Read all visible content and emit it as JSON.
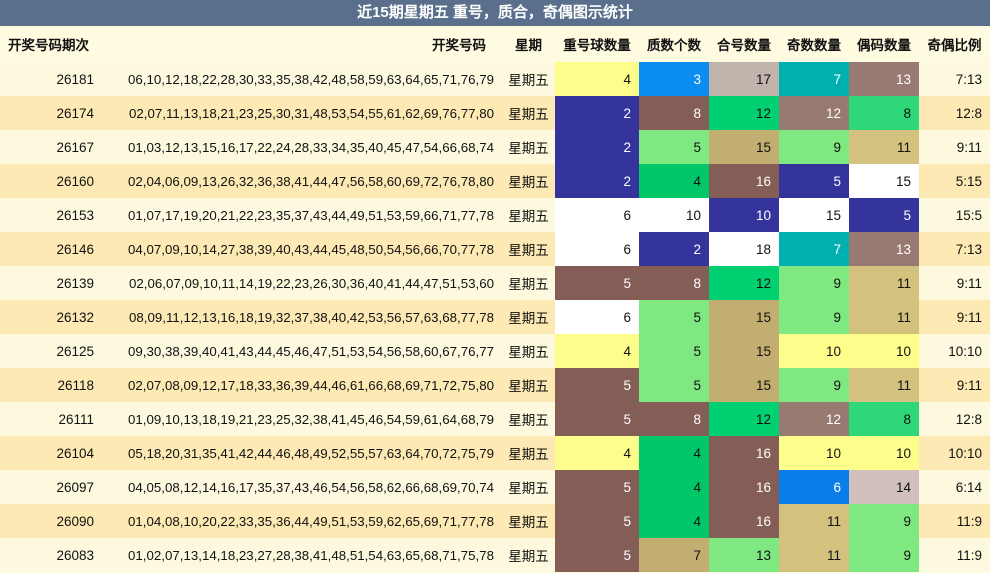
{
  "title": "近15期星期五 重号，质合，奇偶图示统计",
  "headers": {
    "issue": "开奖号码期次",
    "numbers": "开奖号码",
    "weekday": "星期",
    "repeat": "重号球数量",
    "prime": "质数个数",
    "composite": "合号数量",
    "odd": "奇数数量",
    "even": "偶码数量",
    "ratio": "奇偶比例"
  },
  "rows": [
    {
      "issue": "26181",
      "numbers": "06,10,12,18,22,28,30,33,35,38,42,48,58,59,63,64,65,71,76,79",
      "weekday": "星期五",
      "repeat": "4",
      "prime": "3",
      "composite": "17",
      "odd": "7",
      "even": "13",
      "ratio": "7:13"
    },
    {
      "issue": "26174",
      "numbers": "02,07,11,13,18,21,23,25,30,31,48,53,54,55,61,62,69,76,77,80",
      "weekday": "星期五",
      "repeat": "2",
      "prime": "8",
      "composite": "12",
      "odd": "12",
      "even": "8",
      "ratio": "12:8"
    },
    {
      "issue": "26167",
      "numbers": "01,03,12,13,15,16,17,22,24,28,33,34,35,40,45,47,54,66,68,74",
      "weekday": "星期五",
      "repeat": "2",
      "prime": "5",
      "composite": "15",
      "odd": "9",
      "even": "11",
      "ratio": "9:11"
    },
    {
      "issue": "26160",
      "numbers": "02,04,06,09,13,26,32,36,38,41,44,47,56,58,60,69,72,76,78,80",
      "weekday": "星期五",
      "repeat": "2",
      "prime": "4",
      "composite": "16",
      "odd": "5",
      "even": "15",
      "ratio": "5:15"
    },
    {
      "issue": "26153",
      "numbers": "01,07,17,19,20,21,22,23,35,37,43,44,49,51,53,59,66,71,77,78",
      "weekday": "星期五",
      "repeat": "6",
      "prime": "10",
      "composite": "10",
      "odd": "15",
      "even": "5",
      "ratio": "15:5"
    },
    {
      "issue": "26146",
      "numbers": "04,07,09,10,14,27,38,39,40,43,44,45,48,50,54,56,66,70,77,78",
      "weekday": "星期五",
      "repeat": "6",
      "prime": "2",
      "composite": "18",
      "odd": "7",
      "even": "13",
      "ratio": "7:13"
    },
    {
      "issue": "26139",
      "numbers": "02,06,07,09,10,11,14,19,22,23,26,30,36,40,41,44,47,51,53,60",
      "weekday": "星期五",
      "repeat": "5",
      "prime": "8",
      "composite": "12",
      "odd": "9",
      "even": "11",
      "ratio": "9:11"
    },
    {
      "issue": "26132",
      "numbers": "08,09,11,12,13,16,18,19,32,37,38,40,42,53,56,57,63,68,77,78",
      "weekday": "星期五",
      "repeat": "6",
      "prime": "5",
      "composite": "15",
      "odd": "9",
      "even": "11",
      "ratio": "9:11"
    },
    {
      "issue": "26125",
      "numbers": "09,30,38,39,40,41,43,44,45,46,47,51,53,54,56,58,60,67,76,77",
      "weekday": "星期五",
      "repeat": "4",
      "prime": "5",
      "composite": "15",
      "odd": "10",
      "even": "10",
      "ratio": "10:10"
    },
    {
      "issue": "26118",
      "numbers": "02,07,08,09,12,17,18,33,36,39,44,46,61,66,68,69,71,72,75,80",
      "weekday": "星期五",
      "repeat": "5",
      "prime": "5",
      "composite": "15",
      "odd": "9",
      "even": "11",
      "ratio": "9:11"
    },
    {
      "issue": "26111",
      "numbers": "01,09,10,13,18,19,21,23,25,32,38,41,45,46,54,59,61,64,68,79",
      "weekday": "星期五",
      "repeat": "5",
      "prime": "8",
      "composite": "12",
      "odd": "12",
      "even": "8",
      "ratio": "12:8"
    },
    {
      "issue": "26104",
      "numbers": "05,18,20,31,35,41,42,44,46,48,49,52,55,57,63,64,70,72,75,79",
      "weekday": "星期五",
      "repeat": "4",
      "prime": "4",
      "composite": "16",
      "odd": "10",
      "even": "10",
      "ratio": "10:10"
    },
    {
      "issue": "26097",
      "numbers": "04,05,08,12,14,16,17,35,37,43,46,54,56,58,62,66,68,69,70,74",
      "weekday": "星期五",
      "repeat": "5",
      "prime": "4",
      "composite": "16",
      "odd": "6",
      "even": "14",
      "ratio": "6:14"
    },
    {
      "issue": "26090",
      "numbers": "01,04,08,10,20,22,33,35,36,44,49,51,53,59,62,65,69,71,77,78",
      "weekday": "星期五",
      "repeat": "5",
      "prime": "4",
      "composite": "16",
      "odd": "11",
      "even": "9",
      "ratio": "11:9"
    },
    {
      "issue": "26083",
      "numbers": "01,02,07,13,14,18,23,27,28,38,41,48,51,54,63,65,68,71,75,78",
      "weekday": "星期五",
      "repeat": "5",
      "prime": "7",
      "composite": "13",
      "odd": "11",
      "even": "9",
      "ratio": "11:9"
    }
  ],
  "cell_colors": [
    [
      "#fdfd8c",
      "#0a8cf0",
      "#c0b4ac",
      "#00b0b0",
      "#987a72"
    ],
    [
      "#34349c",
      "#845e56",
      "#00d070",
      "#987a72",
      "#2ed878"
    ],
    [
      "#34349c",
      "#80e880",
      "#c2ae70",
      "#80e880",
      "#d2c27e"
    ],
    [
      "#34349c",
      "#00c868",
      "#845e56",
      "#34349c",
      "#ffffff"
    ],
    [
      "#ffffff",
      "#ffffff",
      "#34349c",
      "#ffffff",
      "#34349c"
    ],
    [
      "#ffffff",
      "#34349c",
      "#ffffff",
      "#00b0b0",
      "#987a72"
    ],
    [
      "#845e56",
      "#845e56",
      "#00d070",
      "#80e880",
      "#d2c27e"
    ],
    [
      "#ffffff",
      "#80e880",
      "#c2ae70",
      "#80e880",
      "#d2c27e"
    ],
    [
      "#fdfd8c",
      "#80e880",
      "#c2ae70",
      "#fdfd8c",
      "#fdfd8c"
    ],
    [
      "#845e56",
      "#80e880",
      "#c2ae70",
      "#80e880",
      "#d2c27e"
    ],
    [
      "#845e56",
      "#845e56",
      "#00d070",
      "#987a72",
      "#2ed878"
    ],
    [
      "#fdfd8c",
      "#00c868",
      "#845e56",
      "#fdfd8c",
      "#fdfd8c"
    ],
    [
      "#845e56",
      "#00c868",
      "#845e56",
      "#0a7ee8",
      "#d2c0bc"
    ],
    [
      "#845e56",
      "#00c868",
      "#845e56",
      "#d2c27e",
      "#80e880"
    ],
    [
      "#845e56",
      "#c2ae70",
      "#80e880",
      "#d2c27e",
      "#80e880"
    ]
  ],
  "dark_colors": [
    "#34349c",
    "#845e56",
    "#987a72",
    "#0a8cf0",
    "#00b0b0",
    "#0a7ee8"
  ]
}
